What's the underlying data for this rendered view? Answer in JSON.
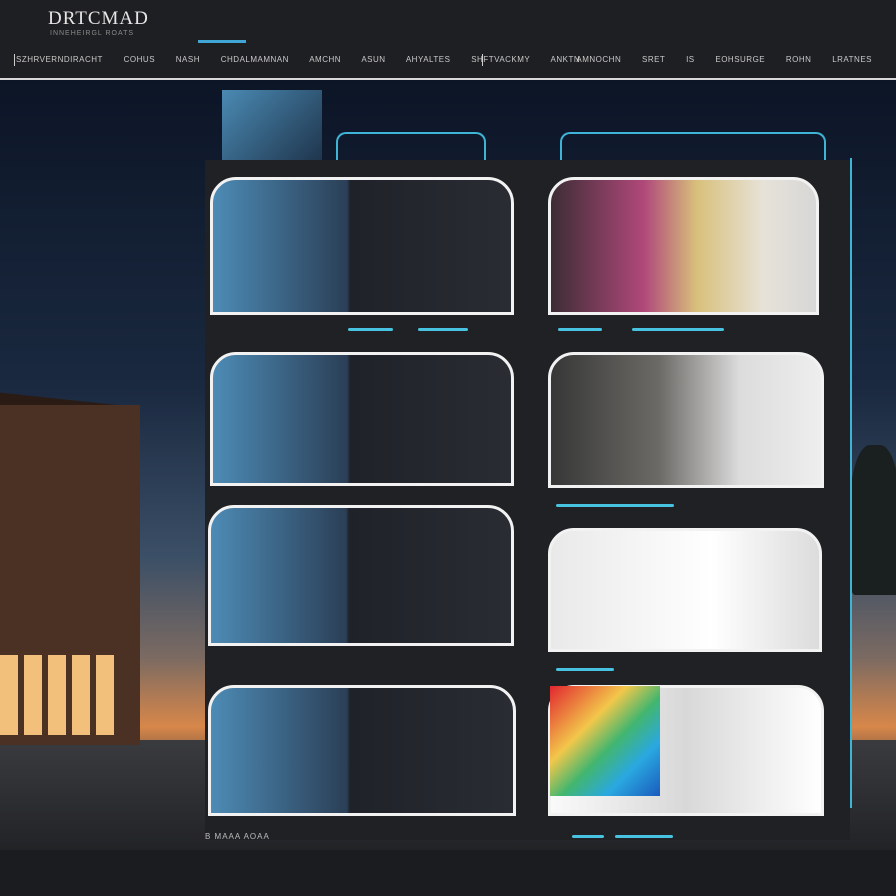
{
  "brand": {
    "logo_text": "DRTCMAD",
    "subtitle": "INNEHEIRGL ROATS"
  },
  "nav_left": [
    "SZHRVERNDIRACHT",
    "COHUS",
    "NASH",
    "CHDALMAMNAN",
    "AMCHN",
    "ASUN",
    "AHYALTES",
    "SHFTVACKMY",
    "ANKTN"
  ],
  "nav_right": [
    "AMNOCHN",
    "SRET",
    "IS",
    "EOHSURGE",
    "ROHN",
    "LRATNES"
  ],
  "footer_text": "B MAAA AOAA",
  "colors": {
    "accent": "#3fa6d6",
    "neon": "#47c2e0",
    "background": "#1b1c1f"
  }
}
